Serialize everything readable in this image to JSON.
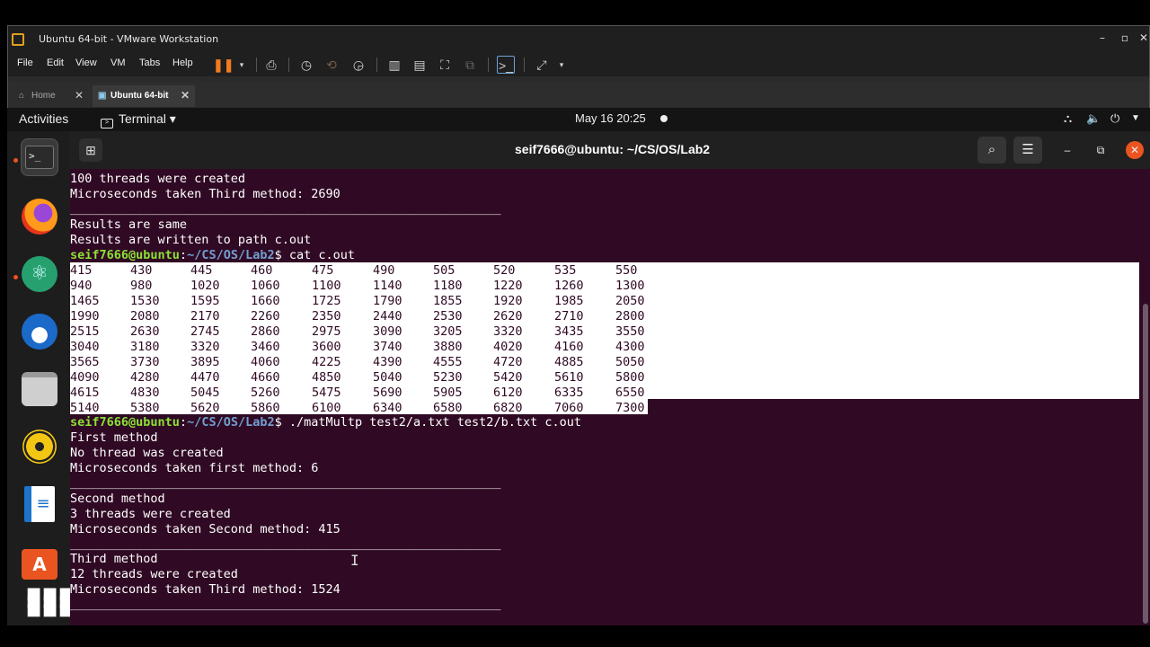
{
  "vmware": {
    "window_title": "Ubuntu 64-bit - VMware Workstation",
    "menu": [
      "File",
      "Edit",
      "View",
      "VM",
      "Tabs",
      "Help"
    ],
    "tabs": [
      {
        "label": "Home",
        "icon": "home-icon"
      },
      {
        "label": "Ubuntu 64-bit",
        "icon": "vm-icon"
      }
    ]
  },
  "gnome": {
    "activities": "Activities",
    "app_menu": "Terminal ▾",
    "clock": "May 16  20:25"
  },
  "terminal": {
    "title": "seif7666@ubuntu: ~/CS/OS/Lab2",
    "prompt_user": "seif7666@ubuntu",
    "prompt_sep": ":",
    "prompt_path": "~/CS/OS/Lab2",
    "lines_top": [
      "100 threads were created",
      "Microseconds taken Third method: 2690",
      "___________________________________________________________",
      "Results are same",
      "Results are written to path c.out"
    ],
    "command1": "$ cat c.out",
    "matrix": [
      [
        "415",
        "430",
        "445",
        "460",
        "475",
        "490",
        "505",
        "520",
        "535",
        "550"
      ],
      [
        "940",
        "980",
        "1020",
        "1060",
        "1100",
        "1140",
        "1180",
        "1220",
        "1260",
        "1300"
      ],
      [
        "1465",
        "1530",
        "1595",
        "1660",
        "1725",
        "1790",
        "1855",
        "1920",
        "1985",
        "2050"
      ],
      [
        "1990",
        "2080",
        "2170",
        "2260",
        "2350",
        "2440",
        "2530",
        "2620",
        "2710",
        "2800"
      ],
      [
        "2515",
        "2630",
        "2745",
        "2860",
        "2975",
        "3090",
        "3205",
        "3320",
        "3435",
        "3550"
      ],
      [
        "3040",
        "3180",
        "3320",
        "3460",
        "3600",
        "3740",
        "3880",
        "4020",
        "4160",
        "4300"
      ],
      [
        "3565",
        "3730",
        "3895",
        "4060",
        "4225",
        "4390",
        "4555",
        "4720",
        "4885",
        "5050"
      ],
      [
        "4090",
        "4280",
        "4470",
        "4660",
        "4850",
        "5040",
        "5230",
        "5420",
        "5610",
        "5800"
      ],
      [
        "4615",
        "4830",
        "5045",
        "5260",
        "5475",
        "5690",
        "5905",
        "6120",
        "6335",
        "6550"
      ],
      [
        "5140",
        "5380",
        "5620",
        "5860",
        "6100",
        "6340",
        "6580",
        "6820",
        "7060",
        "7300"
      ]
    ],
    "command2": "$ ./matMultp test2/a.txt test2/b.txt c.out",
    "lines_bottom": [
      "First method",
      "No thread was created",
      "Microseconds taken first method: 6",
      "___________________________________________________________",
      "Second method",
      "3 threads were created",
      "Microseconds taken Second method: 415",
      "___________________________________________________________",
      "Third method",
      "12 threads were created",
      "Microseconds taken Third method: 1524",
      "___________________________________________________________"
    ]
  }
}
